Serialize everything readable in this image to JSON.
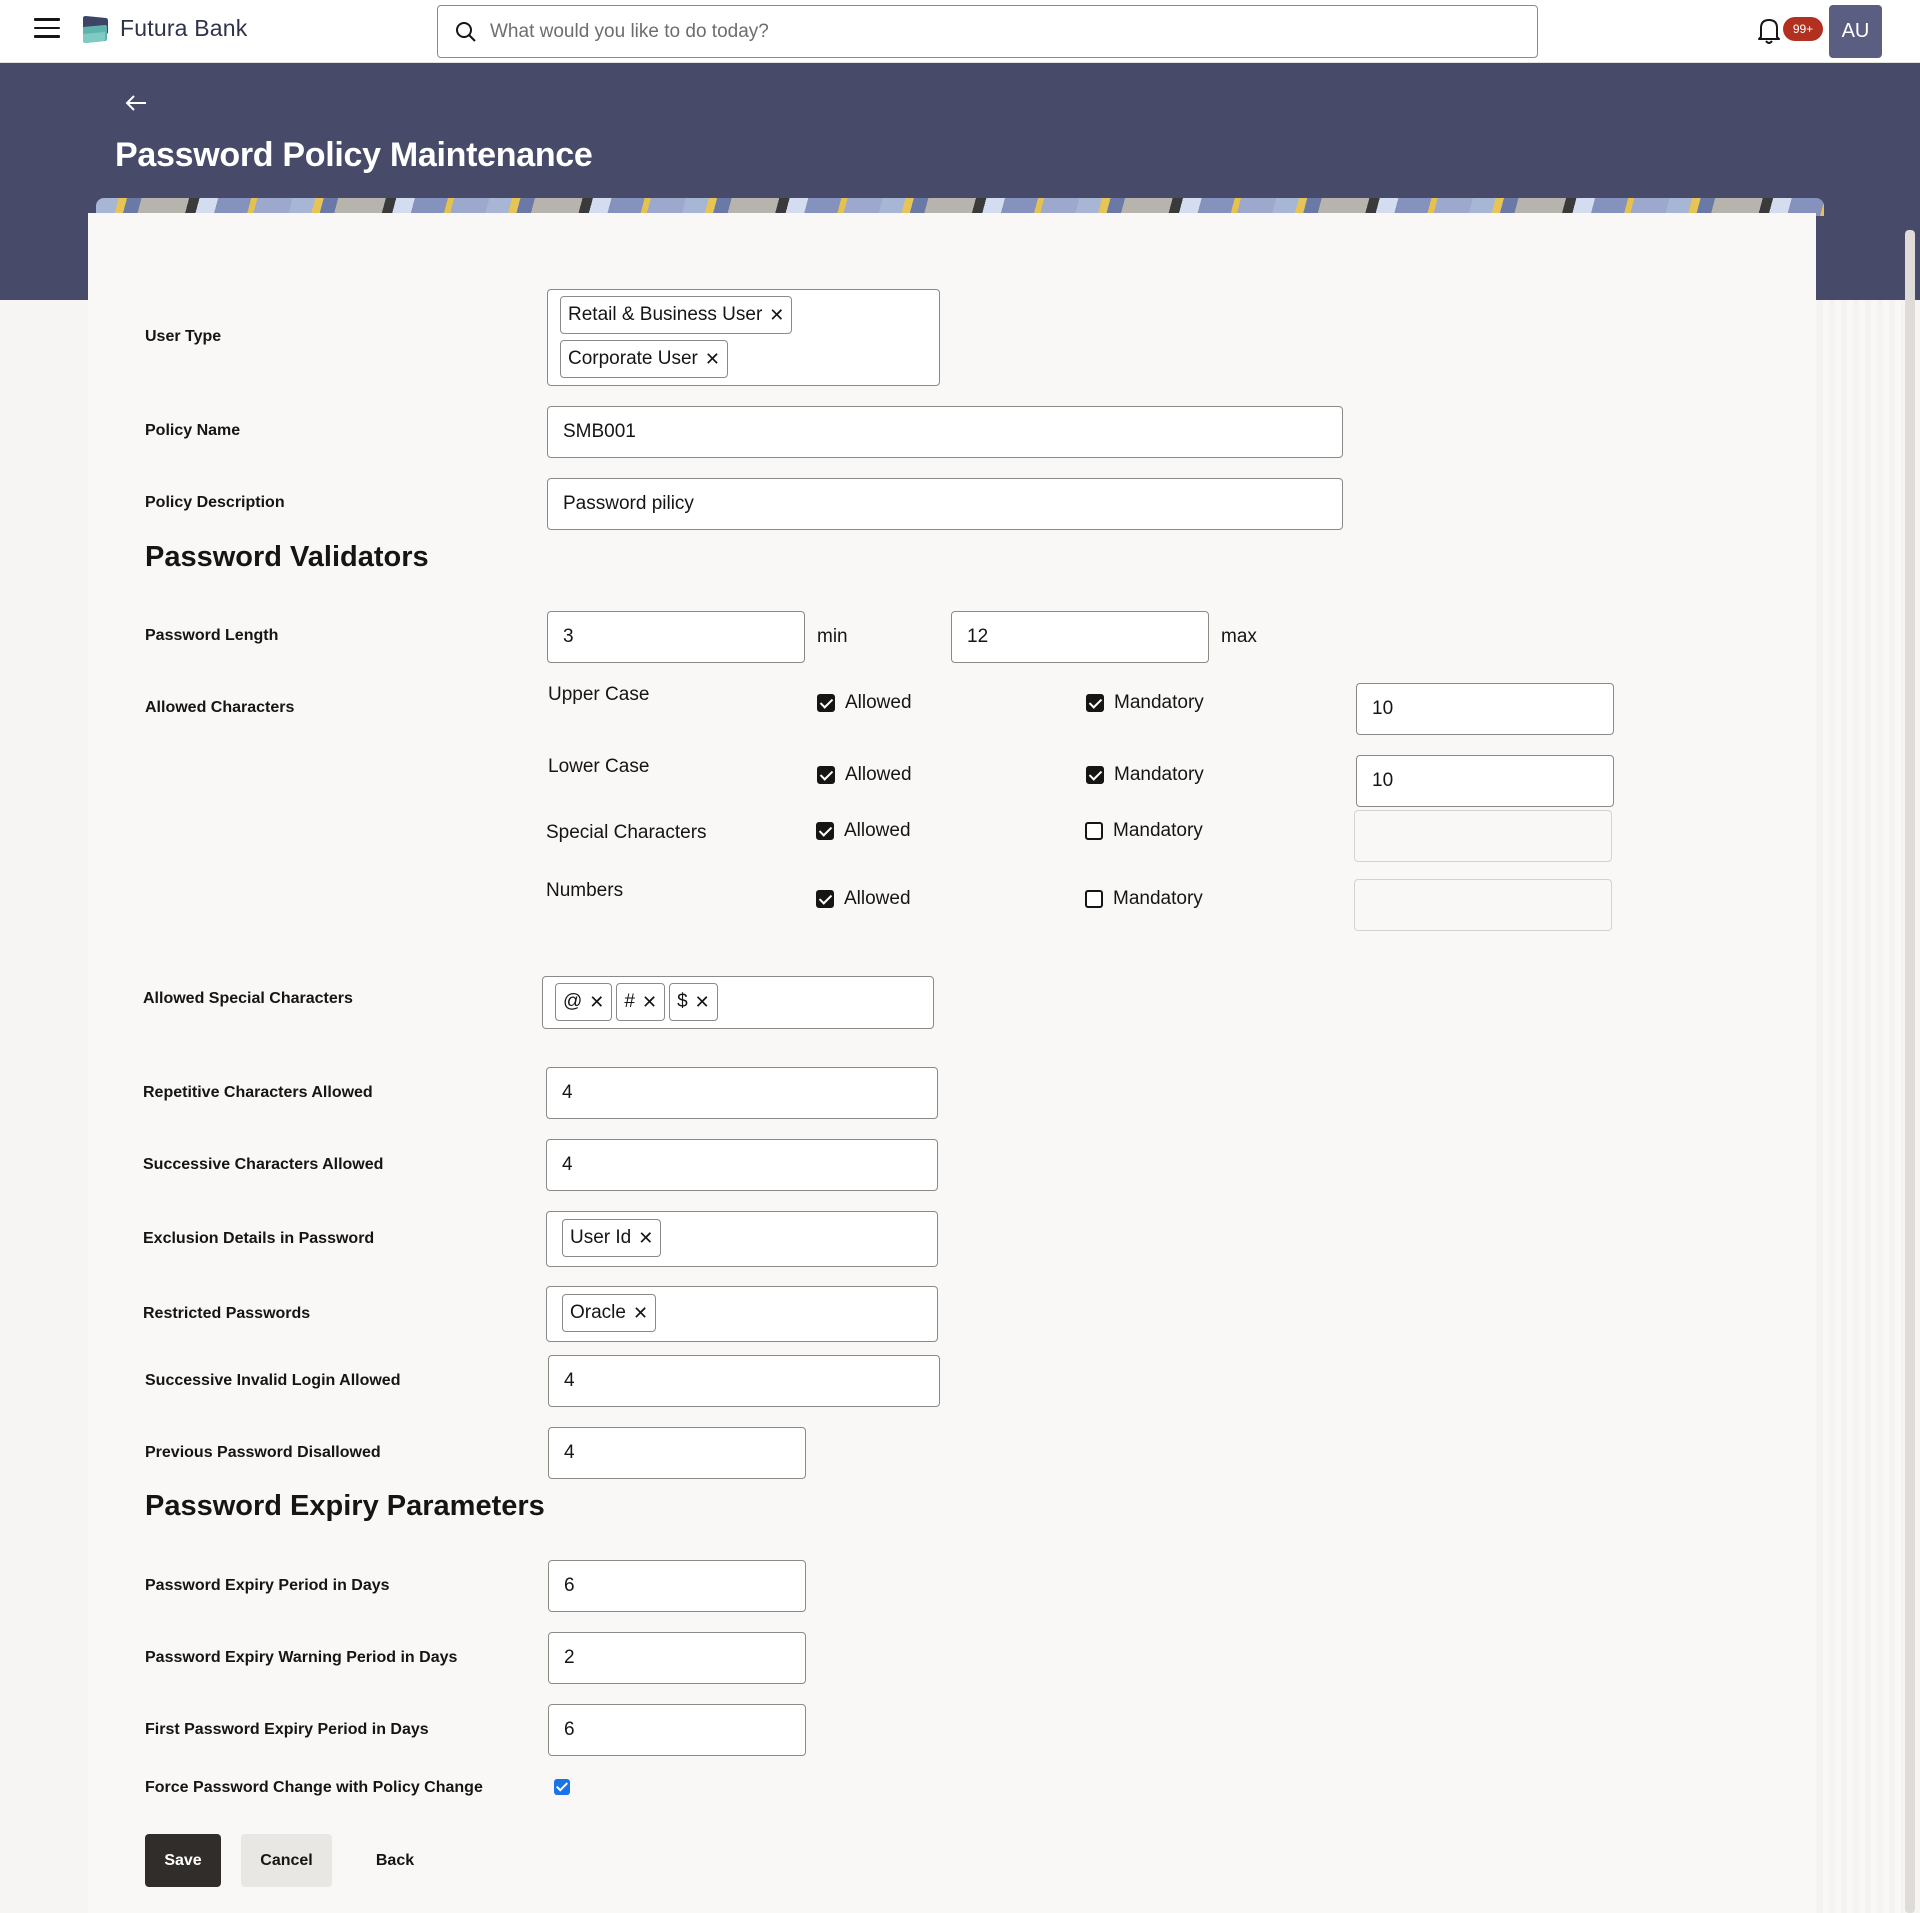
{
  "header": {
    "brand": "Futura Bank",
    "search_placeholder": "What would you like to do today?",
    "notification_count": "99+",
    "avatar_initials": "AU",
    "icons": {
      "menu": "hamburger-icon",
      "logo": "bank-logo-icon",
      "search": "search-icon",
      "notifications": "bell-icon",
      "back": "arrow-left-icon"
    }
  },
  "page": {
    "title": "Password Policy Maintenance"
  },
  "form": {
    "user_type": {
      "label": "User Type",
      "chips": [
        "Retail & Business User",
        "Corporate User"
      ]
    },
    "policy_name": {
      "label": "Policy Name",
      "value": "SMB001"
    },
    "policy_description": {
      "label": "Policy Description",
      "value": "Password pilicy"
    },
    "validators": {
      "heading": "Password Validators",
      "password_length": {
        "label": "Password Length",
        "min": "3",
        "min_label": "min",
        "max": "12",
        "max_label": "max"
      },
      "allowed_characters": {
        "label": "Allowed Characters",
        "allowed_label": "Allowed",
        "mandatory_label": "Mandatory",
        "rows": [
          {
            "name": "Upper Case",
            "allowed": true,
            "mandatory": true,
            "count": "10"
          },
          {
            "name": "Lower Case",
            "allowed": true,
            "mandatory": true,
            "count": "10"
          },
          {
            "name": "Special Characters",
            "allowed": true,
            "mandatory": false,
            "count": ""
          },
          {
            "name": "Numbers",
            "allowed": true,
            "mandatory": false,
            "count": ""
          }
        ]
      },
      "allowed_special_characters": {
        "label": "Allowed Special Characters",
        "chips": [
          "@",
          "#",
          "$"
        ]
      },
      "repetitive_characters": {
        "label": "Repetitive Characters Allowed",
        "value": "4"
      },
      "successive_characters": {
        "label": "Successive Characters Allowed",
        "value": "4"
      },
      "exclusion_details": {
        "label": "Exclusion Details in Password",
        "chips": [
          "User Id"
        ]
      },
      "restricted_passwords": {
        "label": "Restricted Passwords",
        "chips": [
          "Oracle"
        ]
      },
      "successive_invalid_login": {
        "label": "Successive Invalid Login Allowed",
        "value": "4"
      },
      "previous_password_disallowed": {
        "label": "Previous Password Disallowed",
        "value": "4"
      }
    },
    "expiry": {
      "heading": "Password Expiry Parameters",
      "expiry_period": {
        "label": "Password Expiry Period in Days",
        "value": "6"
      },
      "warning_period": {
        "label": "Password Expiry Warning Period in Days",
        "value": "2"
      },
      "first_expiry_period": {
        "label": "First Password Expiry Period in Days",
        "value": "6"
      },
      "force_change": {
        "label": "Force Password Change with Policy Change",
        "checked": true
      }
    }
  },
  "actions": {
    "save": "Save",
    "cancel": "Cancel",
    "back": "Back"
  },
  "colors": {
    "hero": "#474b69",
    "primary_button": "#312d2a",
    "badge": "#b2301f",
    "avatar": "#5a5f82",
    "checkbox_blue": "#1a73e8"
  }
}
